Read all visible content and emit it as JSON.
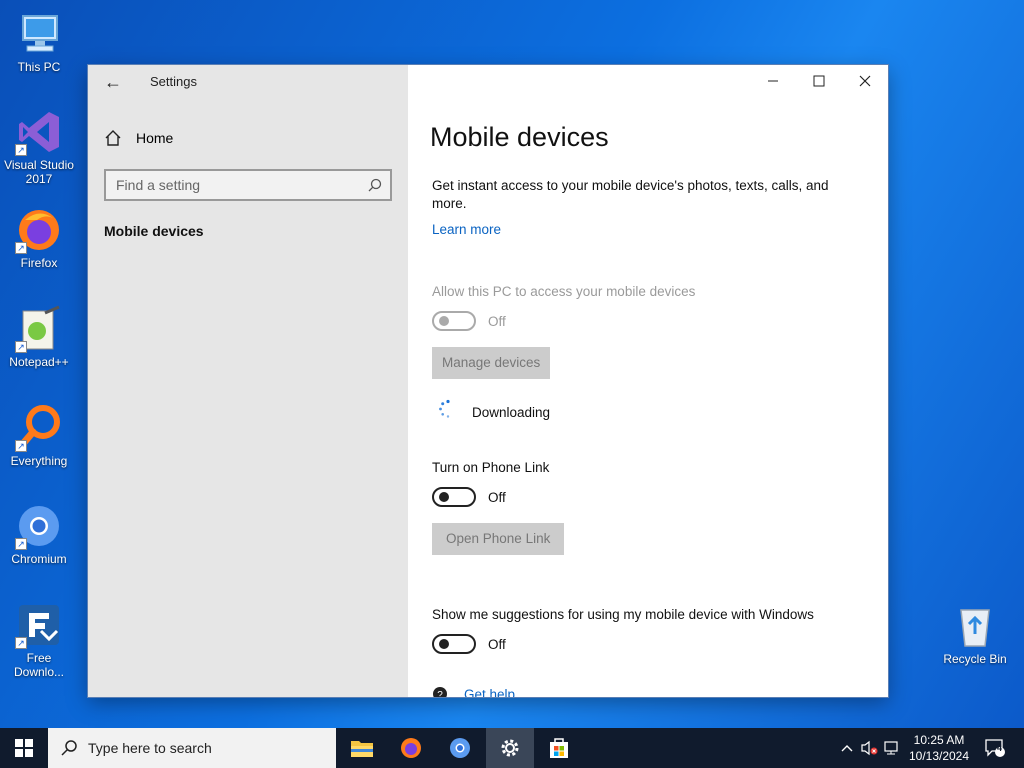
{
  "desktop": {
    "icons": [
      {
        "label": "This PC"
      },
      {
        "label": "Visual Studio 2017"
      },
      {
        "label": "Firefox"
      },
      {
        "label": "Notepad++"
      },
      {
        "label": "Everything"
      },
      {
        "label": "Chromium"
      },
      {
        "label": "Free Downlo..."
      },
      {
        "label": "Recycle Bin"
      }
    ]
  },
  "window": {
    "title": "Settings",
    "nav": {
      "home_label": "Home",
      "search_placeholder": "Find a setting",
      "selected_item": "Mobile devices"
    },
    "content": {
      "title": "Mobile devices",
      "description": "Get instant access to your mobile device's photos, texts, calls, and more.",
      "learn_more": "Learn more",
      "allow_label": "Allow this PC to access your mobile devices",
      "allow_state": "Off",
      "manage_button": "Manage devices",
      "downloading": "Downloading",
      "phone_link_label": "Turn on Phone Link",
      "phone_link_state": "Off",
      "open_phone_link_button": "Open Phone Link",
      "suggestions_label": "Show me suggestions for using my mobile device with Windows",
      "suggestions_state": "Off",
      "get_help": "Get help"
    }
  },
  "taskbar": {
    "search_placeholder": "Type here to search",
    "time": "10:25 AM",
    "date": "10/13/2024",
    "notification_count": "4"
  },
  "colors": {
    "link": "#0a63c2",
    "taskbar": "#101b2d",
    "nav_bg": "#e6e6e6"
  }
}
